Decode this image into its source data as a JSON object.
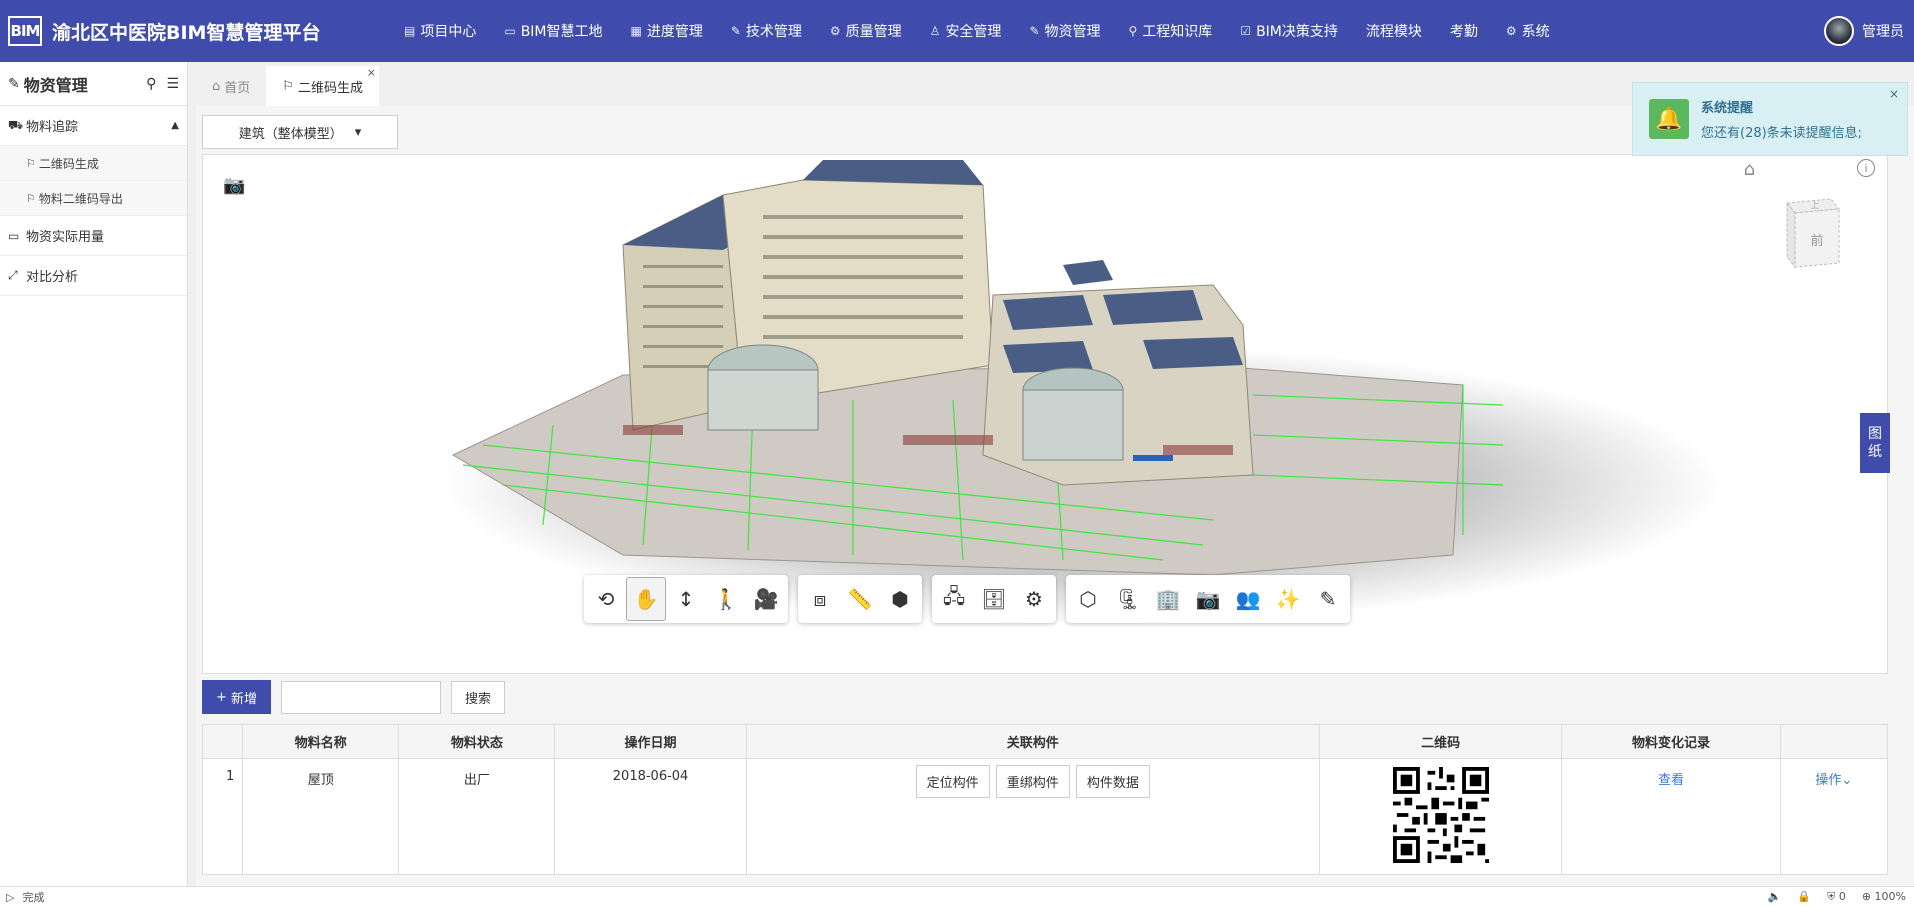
{
  "app": {
    "logo_text": "BIM",
    "title": "渝北区中医院BIM智慧管理平台"
  },
  "nav": [
    {
      "icon": "▤",
      "label": "项目中心"
    },
    {
      "icon": "▭",
      "label": "BIM智慧工地"
    },
    {
      "icon": "▦",
      "label": "进度管理"
    },
    {
      "icon": "✎",
      "label": "技术管理"
    },
    {
      "icon": "⚙",
      "label": "质量管理"
    },
    {
      "icon": "♙",
      "label": "安全管理"
    },
    {
      "icon": "✎",
      "label": "物资管理"
    },
    {
      "icon": "⚲",
      "label": "工程知识库"
    },
    {
      "icon": "☑",
      "label": "BIM决策支持"
    },
    {
      "icon": "",
      "label": "流程模块"
    },
    {
      "icon": "",
      "label": "考勤"
    },
    {
      "icon": "⚙",
      "label": "系统"
    }
  ],
  "user": {
    "name": "管理员"
  },
  "sidebar": {
    "title": "物资管理",
    "items": [
      {
        "label": "物料追踪",
        "icon": "⛟",
        "caret": "▲"
      },
      {
        "label": "二维码生成",
        "icon": "⚐"
      },
      {
        "label": "物料二维码导出",
        "icon": "⚐"
      },
      {
        "label": "物资实际用量",
        "icon": "▭"
      },
      {
        "label": "对比分析",
        "icon": "⤢"
      }
    ]
  },
  "tabs": [
    {
      "label": "首页",
      "icon": "⌂"
    },
    {
      "label": "二维码生成",
      "icon": "⚐",
      "close": "×"
    }
  ],
  "model_select": {
    "value": "建筑（整体模型）",
    "caret": "▾"
  },
  "viewcube": {
    "top": "上",
    "front": "前"
  },
  "side_drawing": {
    "line1": "图",
    "line2": "纸"
  },
  "actions": {
    "add_label": "新增",
    "add_icon": "+",
    "search_label": "搜索",
    "search_value": ""
  },
  "table": {
    "headers": [
      "",
      "物料名称",
      "物料状态",
      "操作日期",
      "关联构件",
      "二维码",
      "物料变化记录",
      ""
    ],
    "rows": [
      {
        "index": "1",
        "name": "屋顶",
        "status": "出厂",
        "date": "2018-06-04",
        "buttons": [
          "定位构件",
          "重绑构件",
          "构件数据"
        ],
        "history_link": "查看",
        "ops_link": "操作",
        "ops_caret": "⌄"
      }
    ]
  },
  "notice": {
    "title": "系统提醒",
    "message": "您还有(28)条未读提醒信息;",
    "close": "×"
  },
  "status": {
    "text": "完成",
    "zoom": "100%",
    "count": "0"
  },
  "colors": {
    "primary": "#3f4cab",
    "notice_bg": "#d8f0f4",
    "notice_text": "#31708f",
    "link": "#3a7bd5",
    "bell": "#5cb85c"
  }
}
